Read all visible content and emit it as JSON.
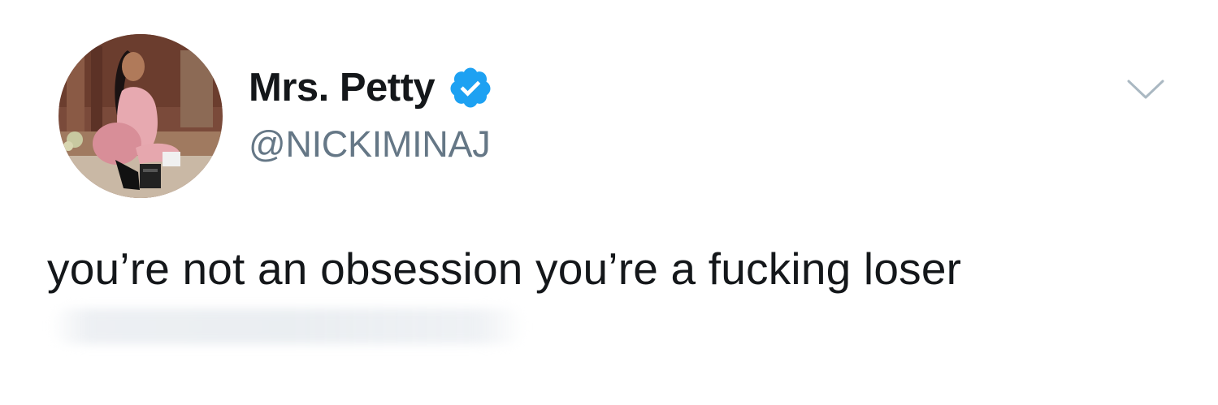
{
  "tweet": {
    "display_name": "Mrs. Petty",
    "handle": "@NICKIMINAJ",
    "verified": true,
    "text": "you’re not an obsession you’re a fucking loser"
  },
  "icons": {
    "verified": "verified-badge-icon",
    "menu": "chevron-down-icon"
  },
  "colors": {
    "name": "#14171a",
    "handle": "#657786",
    "verified": "#1da1f2",
    "chevron": "#aab8c2",
    "background": "#ffffff"
  }
}
